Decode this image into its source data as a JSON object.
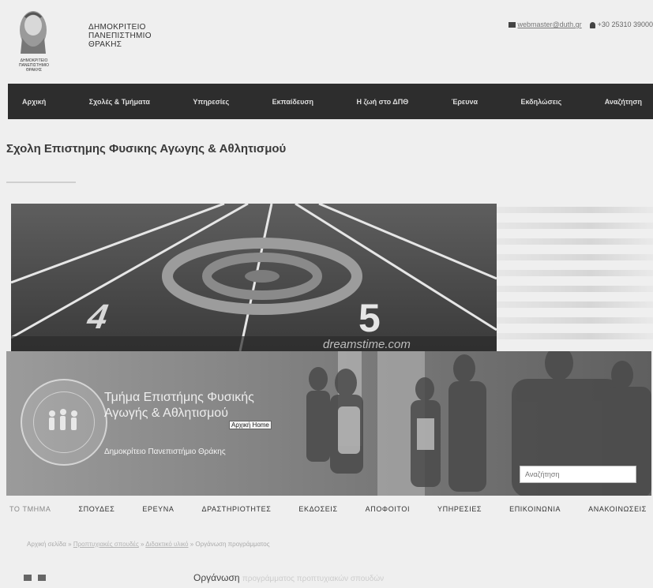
{
  "header": {
    "university_name_lines": [
      "ΔΗΜΟΚΡΙΤΕΙΟ",
      "ΠΑΝΕΠΙΣΤΗΜΙΟ",
      "ΘΡΑΚΗΣ"
    ],
    "logo_caption_lines": [
      "ΔΗΜΟΚΡΙΤΕΙΟ",
      "ΠΑΝΕΠΙΣΤΗΜΙΟ",
      "ΘΡΑΚΗΣ"
    ],
    "email": "webmaster@duth.gr",
    "phone": "+30 25310 39000",
    "email_icon": "envelope-icon",
    "phone_icon": "user-icon"
  },
  "main_nav": [
    "Αρχική",
    "Σχολές & Τμήματα",
    "Υπηρεσίες",
    "Εκπαίδευση",
    "Η ζωή στο ΔΠΘ",
    "Έρευνα",
    "Εκδηλώσεις",
    "Αναζήτηση"
  ],
  "page_title": "Σχολη Επιστημης Φυσικης Αγωγης & Αθλητισμού",
  "hero": {
    "lane_numbers": [
      "4",
      "5"
    ],
    "watermark": "dreamstime.com"
  },
  "department_banner": {
    "title_lines": [
      "Τμήμα Επιστήμης Φυσικής",
      "Αγωγής & Αθλητισμού"
    ],
    "subtitle": "Δημοκρίτειο Πανεπιστήμιο Θράκης",
    "home_button": "Αρχική Home",
    "search_placeholder": "Αναζήτηση"
  },
  "sub_nav": [
    "ΤΟ ΤΜΗΜΑ",
    "ΣΠΟΥΔΕΣ",
    "ΕΡΕΥΝΑ",
    "ΔΡΑΣΤΗΡΙΟΤΗΤΕΣ",
    "ΕΚΔΟΣΕΙΣ",
    "ΑΠΟΦΟΙΤΟΙ",
    "ΥΠΗΡΕΣΙΕΣ",
    "ΕΠΙΚΟΙΝΩΝΙΑ",
    "ΑΝΑΚΟΙΝΩΣΕΙΣ"
  ],
  "breadcrumbs": [
    "Αρχική σελίδα",
    "Προπτυχιακές σπουδές",
    "Διδακτικό υλικό",
    "Οργάνωση προγράμματος"
  ],
  "section_heading": "Οργάνωση",
  "section_heading_tail": "προγράμματος προπτυχιακών σπουδών",
  "bottom_icons": [
    "folder-icon",
    "print-icon"
  ]
}
